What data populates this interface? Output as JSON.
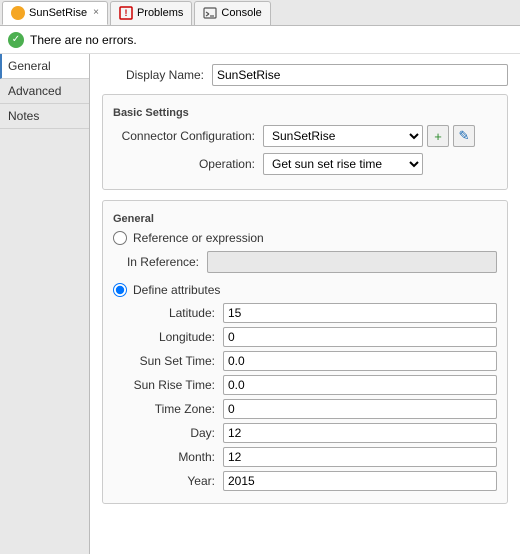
{
  "tabs": [
    {
      "id": "sunsetrise",
      "label": "SunSetRise",
      "type": "sunsetrise",
      "active": true
    },
    {
      "id": "problems",
      "label": "Problems",
      "type": "problems",
      "active": false
    },
    {
      "id": "console",
      "label": "Console",
      "type": "console",
      "active": false
    }
  ],
  "status": {
    "text": "There are no errors."
  },
  "sidebar": {
    "items": [
      {
        "id": "general",
        "label": "General",
        "active": true
      },
      {
        "id": "advanced",
        "label": "Advanced",
        "active": false
      },
      {
        "id": "notes",
        "label": "Notes",
        "active": false
      }
    ]
  },
  "form": {
    "display_name_label": "Display Name:",
    "display_name_value": "SunSetRise",
    "basic_settings_label": "Basic Settings",
    "connector_config_label": "Connector Configuration:",
    "connector_config_value": "SunSetRise",
    "operation_label": "Operation:",
    "operation_value": "Get sun set rise time",
    "general_label": "General",
    "radio_reference_label": "Reference or expression",
    "in_reference_label": "In Reference:",
    "in_reference_value": "",
    "radio_define_label": "Define attributes",
    "fields": [
      {
        "label": "Latitude:",
        "value": "15"
      },
      {
        "label": "Longitude:",
        "value": "0"
      },
      {
        "label": "Sun Set Time:",
        "value": "0.0"
      },
      {
        "label": "Sun Rise Time:",
        "value": "0.0"
      },
      {
        "label": "Time Zone:",
        "value": "0"
      },
      {
        "label": "Day:",
        "value": "12"
      },
      {
        "label": "Month:",
        "value": "12"
      },
      {
        "label": "Year:",
        "value": "2015"
      }
    ]
  },
  "icons": {
    "checkmark": "✓",
    "add": "+",
    "edit": "✎",
    "close": "×"
  }
}
